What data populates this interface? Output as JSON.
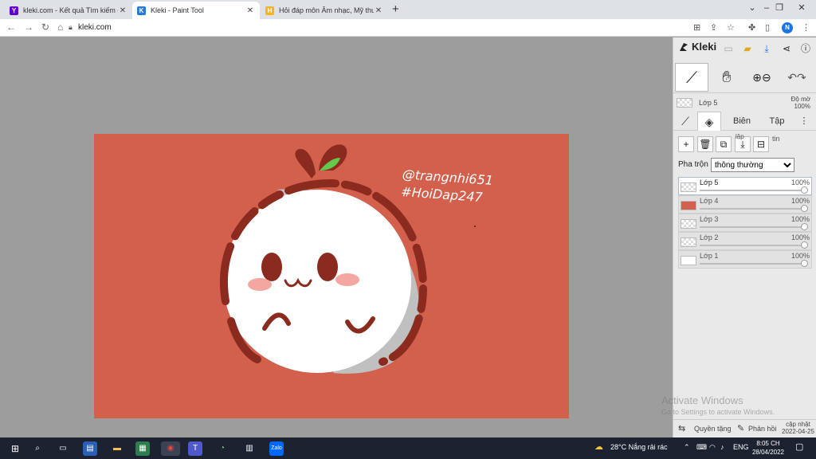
{
  "browser": {
    "tabs": [
      {
        "title": "kleki.com - Kết quả Tìm kiếm của",
        "favicon": "yahoo-icon",
        "color": "#6001d2",
        "fav_letter": "Y"
      },
      {
        "title": "Kleki - Paint Tool",
        "favicon": "kleki-icon",
        "color": "#2b79d6",
        "fav_letter": "K",
        "active": true
      },
      {
        "title": "Hỏi đáp môn Âm nhạc, Mỹ thuật",
        "favicon": "hoidap-icon",
        "color": "#f3b61b",
        "fav_letter": "H"
      }
    ],
    "url": "kleki.com"
  },
  "canvas": {
    "background": "#d2604c",
    "signature_line1": "@trangnhi651",
    "signature_line2": "#HoiDap247"
  },
  "panel": {
    "logo": "Kleki",
    "layer_hint": {
      "name": "Lớp 5",
      "opacity_label": "Độ mờ",
      "opacity": "100%"
    },
    "tabs": {
      "edit": "Biên",
      "file": "Tập"
    },
    "actions": {
      "merge_label": "lập",
      "info_label": "tin"
    },
    "blend_label": "Pha trộn",
    "blend_mode": "thông thường",
    "layers": [
      {
        "name": "Lớp 5",
        "opacity": "100%",
        "active": true
      },
      {
        "name": "Lớp 4",
        "opacity": "100%"
      },
      {
        "name": "Lớp 3",
        "opacity": "100%"
      },
      {
        "name": "Lớp 2",
        "opacity": "100%"
      },
      {
        "name": "Lớp 1",
        "opacity": "100%"
      }
    ],
    "footer": {
      "rotate": "Quyền tặng",
      "feedback": "Phản hồi",
      "updated_label": "cập nhật",
      "updated_date": "2022-04-25"
    }
  },
  "watermark": {
    "line1": "Activate Windows",
    "line2": "Go to Settings to activate Windows."
  },
  "taskbar": {
    "weather": "28°C  Nắng rải rác",
    "lang": "ENG",
    "time": "8:05 CH",
    "date": "28/04/2022"
  },
  "colors": {
    "accent": "#1a73e8",
    "outline": "#8b2a1e",
    "leaf": "#63c94c",
    "blush": "#f4a6a0"
  }
}
